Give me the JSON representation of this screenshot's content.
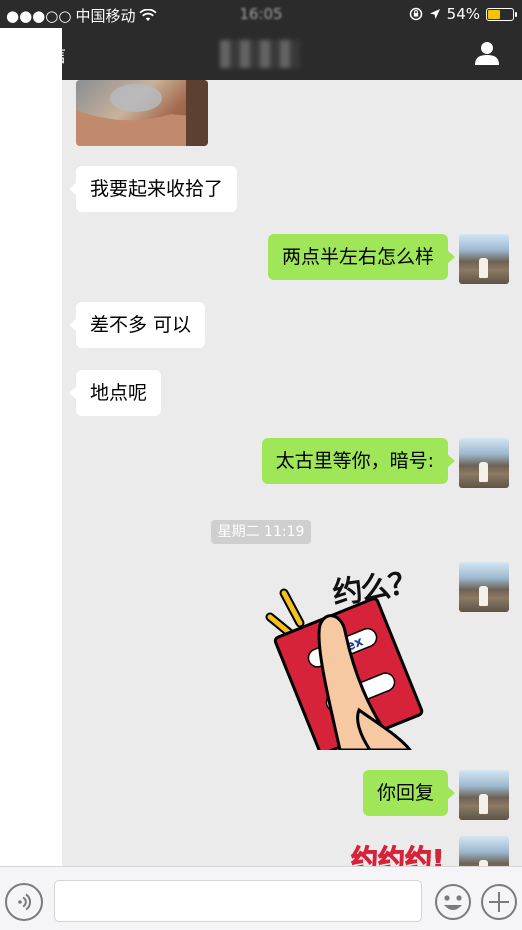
{
  "status_bar": {
    "signal": "●●●○○",
    "carrier": "中国移动",
    "time": "16:05",
    "battery_percent": "54%",
    "battery_level": 0.54
  },
  "nav": {
    "back_label": "信"
  },
  "messages": [
    {
      "id": "m1",
      "direction": "in",
      "text": "我要起来收拾了"
    },
    {
      "id": "m2",
      "direction": "out",
      "text": "两点半左右怎么样"
    },
    {
      "id": "m3",
      "direction": "in",
      "text": "差不多 可以"
    },
    {
      "id": "m4",
      "direction": "in",
      "text": "地点呢"
    },
    {
      "id": "m5",
      "direction": "out",
      "text": "太古里等你，暗号:"
    },
    {
      "id": "m6",
      "direction": "out",
      "text": "你回复"
    }
  ],
  "timestamp": "星期二 11:19",
  "sticker_1": {
    "text": "约么？",
    "condom_brand": "durex"
  },
  "sticker_2": {
    "text": "约约约!"
  },
  "colors": {
    "accent_green": "#9fe658",
    "nav_bg": "#2b2b2b",
    "chat_bg": "#ebebeb",
    "sticker_red": "#d6233a"
  }
}
